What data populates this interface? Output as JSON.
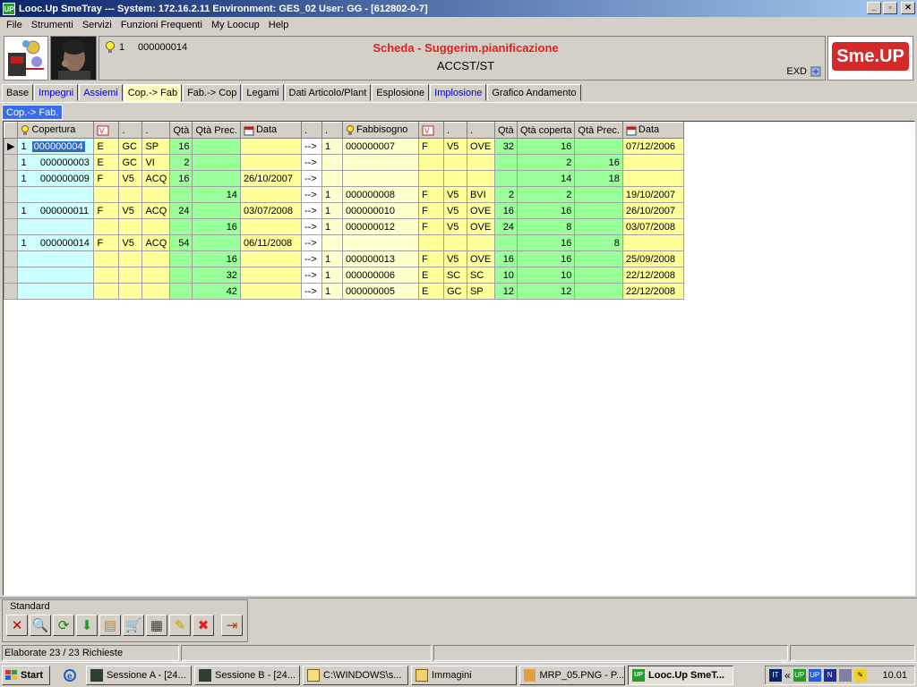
{
  "window": {
    "app_icon_text": "UP",
    "title": "Looc.Up SmeTray --- System: 172.16.2.11 Environment: GES_02 User: GG - [612802-0-7]",
    "minimize": "_",
    "restore": "▫",
    "close": "✕"
  },
  "menu": [
    "File",
    "Strumenti",
    "Servizi",
    "Funzioni Frequenti",
    "My Loocup",
    "Help"
  ],
  "header": {
    "num1": "1",
    "num2": "000000014",
    "title": "Scheda - Suggerim.pianificazione",
    "subtitle": "ACCST/ST",
    "exd": "EXD",
    "logo": "Sme.UP"
  },
  "tabs": [
    {
      "label": "Base",
      "style": "normal"
    },
    {
      "label": "Impegni",
      "style": "link"
    },
    {
      "label": "Assiemi",
      "style": "link"
    },
    {
      "label": "Cop.-> Fab",
      "style": "active"
    },
    {
      "label": "Fab.-> Cop",
      "style": "normal"
    },
    {
      "label": "Legami",
      "style": "normal"
    },
    {
      "label": "Dati Articolo/Plant",
      "style": "normal"
    },
    {
      "label": "Esplosione",
      "style": "normal"
    },
    {
      "label": "Implosione",
      "style": "link"
    },
    {
      "label": "Grafico Andamento",
      "style": "normal"
    }
  ],
  "subtab": "Cop.-> Fab.",
  "grid": {
    "headers": [
      "",
      "Copertura",
      "",
      ".",
      ".",
      "Qtà",
      "Qtà Prec.",
      "Data",
      ".",
      ".",
      "Fabbisogno",
      "",
      ".",
      ".",
      "Qtà",
      "Qtà coperta",
      "Qtà Prec.",
      "Data"
    ],
    "rows": [
      [
        "▶",
        "1     000000004",
        "E",
        "GC",
        "SP",
        "16",
        "",
        "",
        "-->",
        "1",
        "000000007",
        "F",
        "V5",
        "OVE",
        "32",
        "16",
        "",
        "07/12/2006"
      ],
      [
        "",
        "1     000000003",
        "E",
        "GC",
        "VI",
        "2",
        "",
        "",
        "-->",
        "",
        "",
        "",
        "",
        "",
        "",
        "2",
        "16",
        ""
      ],
      [
        "",
        "1     000000009",
        "F",
        "V5",
        "ACQ",
        "16",
        "",
        "26/10/2007",
        "-->",
        "",
        "",
        "",
        "",
        "",
        "",
        "14",
        "18",
        ""
      ],
      [
        "",
        "",
        "",
        "",
        "",
        "",
        "14",
        "",
        "-->",
        "1",
        "000000008",
        "F",
        "V5",
        "BVI",
        "2",
        "2",
        "",
        "19/10/2007"
      ],
      [
        "",
        "1     000000011",
        "F",
        "V5",
        "ACQ",
        "24",
        "",
        "03/07/2008",
        "-->",
        "1",
        "000000010",
        "F",
        "V5",
        "OVE",
        "16",
        "16",
        "",
        "26/10/2007"
      ],
      [
        "",
        "",
        "",
        "",
        "",
        "",
        "16",
        "",
        "-->",
        "1",
        "000000012",
        "F",
        "V5",
        "OVE",
        "24",
        "8",
        "",
        "03/07/2008"
      ],
      [
        "",
        "1     000000014",
        "F",
        "V5",
        "ACQ",
        "54",
        "",
        "06/11/2008",
        "-->",
        "",
        "",
        "",
        "",
        "",
        "",
        "16",
        "8",
        ""
      ],
      [
        "",
        "",
        "",
        "",
        "",
        "",
        "16",
        "",
        "-->",
        "1",
        "000000013",
        "F",
        "V5",
        "OVE",
        "16",
        "16",
        "",
        "25/09/2008"
      ],
      [
        "",
        "",
        "",
        "",
        "",
        "",
        "32",
        "",
        "-->",
        "1",
        "000000006",
        "E",
        "SC",
        "SC",
        "10",
        "10",
        "",
        "22/12/2008"
      ],
      [
        "",
        "",
        "",
        "",
        "",
        "",
        "42",
        "",
        "-->",
        "1",
        "000000005",
        "E",
        "GC",
        "SP",
        "12",
        "12",
        "",
        "22/12/2008"
      ]
    ]
  },
  "toolbar": {
    "label": "Standard",
    "buttons": [
      {
        "icon": "cancel-x-icon",
        "glyph": "✕",
        "color": "#cc0000"
      },
      {
        "icon": "magnifier-icon",
        "glyph": "🔍",
        "color": "#444444"
      },
      {
        "icon": "refresh-icon",
        "glyph": "⟳",
        "color": "#208020"
      },
      {
        "icon": "green-arrow-icon",
        "glyph": "⬇",
        "color": "#20a020"
      },
      {
        "icon": "document-icon",
        "glyph": "▤",
        "color": "#c08040"
      },
      {
        "icon": "cart-icon",
        "glyph": "🛒",
        "color": "#404040"
      },
      {
        "icon": "chart-icon",
        "glyph": "▦",
        "color": "#404040"
      },
      {
        "icon": "tools-icon",
        "glyph": "✎",
        "color": "#c0a000"
      },
      {
        "icon": "stop-icon",
        "glyph": "✖",
        "color": "#dd2020"
      },
      {
        "icon": "exit-icon",
        "glyph": "⇥",
        "color": "#c04000"
      }
    ]
  },
  "status": [
    "Elaborate 23 / 23 Richieste",
    "",
    "",
    "",
    ""
  ],
  "taskbar": {
    "start": "Start",
    "tasks": [
      {
        "label": "Sessione A - [24...",
        "active": false
      },
      {
        "label": "Sessione B - [24...",
        "active": false
      },
      {
        "label": "C:\\WINDOWS\\s...",
        "active": false
      },
      {
        "label": "Immagini",
        "active": false
      },
      {
        "label": "MRP_05.PNG - P...",
        "active": false
      },
      {
        "label": "Looc.Up SmeT...",
        "active": true
      }
    ],
    "tray_lang": "IT",
    "tray_arrows": "«",
    "clock": "10.01"
  }
}
